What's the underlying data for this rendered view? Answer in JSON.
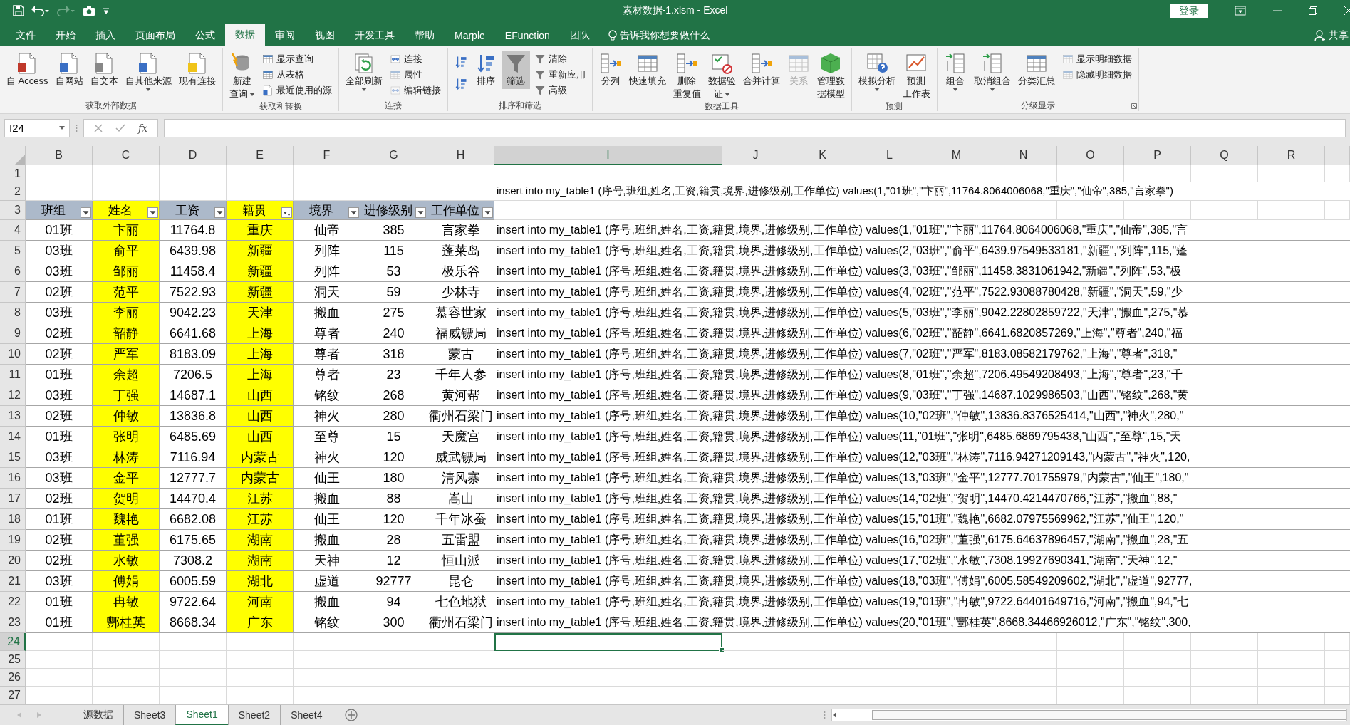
{
  "title_bar": {
    "title": "素材数据-1.xlsm - Excel",
    "login": "登录",
    "quick_access": [
      {
        "kind": "save",
        "disabled": false
      },
      {
        "kind": "undo",
        "disabled": false
      },
      {
        "kind": "redo",
        "disabled": true
      },
      {
        "kind": "camera",
        "disabled": false
      }
    ]
  },
  "menu_tabs": [
    {
      "label": "文件",
      "selected": false
    },
    {
      "label": "开始",
      "selected": false
    },
    {
      "label": "插入",
      "selected": false
    },
    {
      "label": "页面布局",
      "selected": false
    },
    {
      "label": "公式",
      "selected": false
    },
    {
      "label": "数据",
      "selected": true
    },
    {
      "label": "审阅",
      "selected": false
    },
    {
      "label": "视图",
      "selected": false
    },
    {
      "label": "开发工具",
      "selected": false
    },
    {
      "label": "帮助",
      "selected": false
    },
    {
      "label": "Marple",
      "selected": false
    },
    {
      "label": "EFunction",
      "selected": false
    },
    {
      "label": "团队",
      "selected": false
    }
  ],
  "tell_me": "告诉我你想要做什么",
  "share": "共享",
  "ribbon": {
    "groups": [
      {
        "label": "获取外部数据",
        "items": [
          {
            "kind": "large",
            "lines": [
              "自 Access"
            ],
            "disabled": false,
            "pressed": false,
            "dropdown": false
          },
          {
            "kind": "large",
            "lines": [
              "自网站"
            ],
            "disabled": false,
            "pressed": false,
            "dropdown": false
          },
          {
            "kind": "large",
            "lines": [
              "自文本"
            ],
            "disabled": false,
            "pressed": false,
            "dropdown": false
          },
          {
            "kind": "large",
            "lines": [
              "自其他来源"
            ],
            "disabled": false,
            "pressed": false,
            "dropdown": true
          },
          {
            "kind": "large",
            "lines": [
              "现有连接"
            ],
            "disabled": false,
            "pressed": false,
            "dropdown": false
          }
        ]
      },
      {
        "label": "获取和转换",
        "items": [
          {
            "kind": "large",
            "lines": [
              "新建",
              "查询"
            ],
            "disabled": false,
            "pressed": false,
            "dropdown": true
          },
          {
            "kind": "small",
            "label": "显示查询",
            "disabled": false,
            "pressed": false,
            "dropdown": false
          },
          {
            "kind": "small",
            "label": "从表格",
            "disabled": false,
            "pressed": false,
            "dropdown": false
          },
          {
            "kind": "small",
            "label": "最近使用的源",
            "disabled": false,
            "pressed": false,
            "dropdown": false
          }
        ]
      },
      {
        "label": "连接",
        "items": [
          {
            "kind": "large",
            "lines": [
              "全部刷新"
            ],
            "disabled": false,
            "pressed": false,
            "dropdown": true
          },
          {
            "kind": "small",
            "label": "连接",
            "disabled": false,
            "pressed": false,
            "dropdown": false
          },
          {
            "kind": "small",
            "label": "属性",
            "disabled": true,
            "pressed": false,
            "dropdown": false
          },
          {
            "kind": "small",
            "label": "编辑链接",
            "disabled": true,
            "pressed": false,
            "dropdown": false
          }
        ]
      },
      {
        "label": "排序和筛选",
        "items": [
          {
            "kind": "icon",
            "disabled": false,
            "pressed": false,
            "dropdown": false
          },
          {
            "kind": "icon",
            "disabled": false,
            "pressed": false,
            "dropdown": false
          },
          {
            "kind": "large",
            "lines": [
              "排序"
            ],
            "disabled": false,
            "pressed": false,
            "dropdown": false
          },
          {
            "kind": "large",
            "lines": [
              "筛选"
            ],
            "disabled": false,
            "pressed": true,
            "dropdown": false
          },
          {
            "kind": "small",
            "label": "清除",
            "disabled": false,
            "pressed": false,
            "dropdown": false
          },
          {
            "kind": "small",
            "label": "重新应用",
            "disabled": false,
            "pressed": false,
            "dropdown": false
          },
          {
            "kind": "small",
            "label": "高级",
            "disabled": false,
            "pressed": false,
            "dropdown": false
          }
        ]
      },
      {
        "label": "数据工具",
        "items": [
          {
            "kind": "large",
            "lines": [
              "分列"
            ],
            "disabled": false,
            "pressed": false,
            "dropdown": false
          },
          {
            "kind": "large",
            "lines": [
              "快速填充"
            ],
            "disabled": false,
            "pressed": false,
            "dropdown": false
          },
          {
            "kind": "large",
            "lines": [
              "删除",
              "重复值"
            ],
            "disabled": false,
            "pressed": false,
            "dropdown": false
          },
          {
            "kind": "large",
            "lines": [
              "数据验",
              "证"
            ],
            "disabled": false,
            "pressed": false,
            "dropdown": true
          },
          {
            "kind": "large",
            "lines": [
              "合并计算"
            ],
            "disabled": false,
            "pressed": false,
            "dropdown": false
          },
          {
            "kind": "large",
            "lines": [
              "关系"
            ],
            "disabled": true,
            "pressed": false,
            "dropdown": false
          },
          {
            "kind": "large",
            "lines": [
              "管理数",
              "据模型"
            ],
            "disabled": false,
            "pressed": false,
            "dropdown": false
          }
        ]
      },
      {
        "label": "预测",
        "items": [
          {
            "kind": "large",
            "lines": [
              "模拟分析"
            ],
            "disabled": false,
            "pressed": false,
            "dropdown": true
          },
          {
            "kind": "large",
            "lines": [
              "预测",
              "工作表"
            ],
            "disabled": false,
            "pressed": false,
            "dropdown": false
          }
        ]
      },
      {
        "label": "分级显示",
        "items": [
          {
            "kind": "large",
            "lines": [
              "组合"
            ],
            "disabled": false,
            "pressed": false,
            "dropdown": true
          },
          {
            "kind": "large",
            "lines": [
              "取消组合"
            ],
            "disabled": false,
            "pressed": false,
            "dropdown": true
          },
          {
            "kind": "large",
            "lines": [
              "分类汇总"
            ],
            "disabled": false,
            "pressed": false,
            "dropdown": false
          },
          {
            "kind": "small",
            "label": "显示明细数据",
            "disabled": true,
            "pressed": false,
            "dropdown": false
          },
          {
            "kind": "small",
            "label": "隐藏明细数据",
            "disabled": true,
            "pressed": false,
            "dropdown": false
          }
        ]
      }
    ]
  },
  "formula_bar": {
    "name_box": "I24",
    "fx": "fx"
  },
  "column_letters": [
    {
      "label": "B",
      "selected": false
    },
    {
      "label": "C",
      "selected": false
    },
    {
      "label": "D",
      "selected": false
    },
    {
      "label": "E",
      "selected": false
    },
    {
      "label": "F",
      "selected": false
    },
    {
      "label": "G",
      "selected": false
    },
    {
      "label": "H",
      "selected": false
    },
    {
      "label": "I",
      "selected": true
    },
    {
      "label": "J",
      "selected": false
    },
    {
      "label": "K",
      "selected": false
    },
    {
      "label": "L",
      "selected": false
    },
    {
      "label": "M",
      "selected": false
    },
    {
      "label": "N",
      "selected": false
    },
    {
      "label": "O",
      "selected": false
    },
    {
      "label": "P",
      "selected": false
    },
    {
      "label": "Q",
      "selected": false
    },
    {
      "label": "R",
      "selected": false
    }
  ],
  "row_numbers": [
    {
      "label": "1",
      "selected": false
    },
    {
      "label": "2",
      "selected": false
    },
    {
      "label": "3",
      "selected": false
    },
    {
      "label": "4",
      "selected": false
    },
    {
      "label": "5",
      "selected": false
    },
    {
      "label": "6",
      "selected": false
    },
    {
      "label": "7",
      "selected": false
    },
    {
      "label": "8",
      "selected": false
    },
    {
      "label": "9",
      "selected": false
    },
    {
      "label": "10",
      "selected": false
    },
    {
      "label": "11",
      "selected": false
    },
    {
      "label": "12",
      "selected": false
    },
    {
      "label": "13",
      "selected": false
    },
    {
      "label": "14",
      "selected": false
    },
    {
      "label": "15",
      "selected": false
    },
    {
      "label": "16",
      "selected": false
    },
    {
      "label": "17",
      "selected": false
    },
    {
      "label": "18",
      "selected": false
    },
    {
      "label": "19",
      "selected": false
    },
    {
      "label": "20",
      "selected": false
    },
    {
      "label": "21",
      "selected": false
    },
    {
      "label": "22",
      "selected": false
    },
    {
      "label": "23",
      "selected": false
    },
    {
      "label": "24",
      "selected": true
    },
    {
      "label": "25",
      "selected": false
    },
    {
      "label": "26",
      "selected": false
    },
    {
      "label": "27",
      "selected": false
    }
  ],
  "cell_i2": "insert into my_table1 (序号,班组,姓名,工资,籍贯,境界,进修级别,工作单位) values(1,\"01班\",\"卞丽\",11764.8064006068,\"重庆\",\"仙帝\",385,\"言家拳\")",
  "table": {
    "columns": [
      {
        "label": "班组",
        "highlighted": false,
        "sorted": false
      },
      {
        "label": "姓名",
        "highlighted": true,
        "sorted": false
      },
      {
        "label": "工资",
        "highlighted": false,
        "sorted": false
      },
      {
        "label": "籍贯",
        "highlighted": true,
        "sorted": true
      },
      {
        "label": "境界",
        "highlighted": false,
        "sorted": false
      },
      {
        "label": "进修级别",
        "highlighted": false,
        "sorted": false
      },
      {
        "label": "工作单位",
        "highlighted": false,
        "sorted": false
      }
    ],
    "rows": [
      {
        "cells": [
          "01班",
          "卞丽",
          "11764.8",
          "重庆",
          "仙帝",
          "385",
          "言家拳"
        ],
        "sql": "insert into my_table1 (序号,班组,姓名,工资,籍贯,境界,进修级别,工作单位) values(1,\"01班\",\"卞丽\",11764.8064006068,\"重庆\",\"仙帝\",385,\"言"
      },
      {
        "cells": [
          "03班",
          "俞平",
          "6439.98",
          "新疆",
          "列阵",
          "115",
          "蓬莱岛"
        ],
        "sql": "insert into my_table1 (序号,班组,姓名,工资,籍贯,境界,进修级别,工作单位) values(2,\"03班\",\"俞平\",6439.97549533181,\"新疆\",\"列阵\",115,\"蓬"
      },
      {
        "cells": [
          "03班",
          "邹丽",
          "11458.4",
          "新疆",
          "列阵",
          "53",
          "极乐谷"
        ],
        "sql": "insert into my_table1 (序号,班组,姓名,工资,籍贯,境界,进修级别,工作单位) values(3,\"03班\",\"邹丽\",11458.3831061942,\"新疆\",\"列阵\",53,\"极"
      },
      {
        "cells": [
          "02班",
          "范平",
          "7522.93",
          "新疆",
          "洞天",
          "59",
          "少林寺"
        ],
        "sql": "insert into my_table1 (序号,班组,姓名,工资,籍贯,境界,进修级别,工作单位) values(4,\"02班\",\"范平\",7522.93088780428,\"新疆\",\"洞天\",59,\"少"
      },
      {
        "cells": [
          "03班",
          "李丽",
          "9042.23",
          "天津",
          "搬血",
          "275",
          "慕容世家"
        ],
        "sql": "insert into my_table1 (序号,班组,姓名,工资,籍贯,境界,进修级别,工作单位) values(5,\"03班\",\"李丽\",9042.22802859722,\"天津\",\"搬血\",275,\"慕"
      },
      {
        "cells": [
          "02班",
          "韶静",
          "6641.68",
          "上海",
          "尊者",
          "240",
          "福威镖局"
        ],
        "sql": "insert into my_table1 (序号,班组,姓名,工资,籍贯,境界,进修级别,工作单位) values(6,\"02班\",\"韶静\",6641.6820857269,\"上海\",\"尊者\",240,\"福"
      },
      {
        "cells": [
          "02班",
          "严军",
          "8183.09",
          "上海",
          "尊者",
          "318",
          "蒙古"
        ],
        "sql": "insert into my_table1 (序号,班组,姓名,工资,籍贯,境界,进修级别,工作单位) values(7,\"02班\",\"严军\",8183.08582179762,\"上海\",\"尊者\",318,\""
      },
      {
        "cells": [
          "01班",
          "余超",
          "7206.5",
          "上海",
          "尊者",
          "23",
          "千年人参"
        ],
        "sql": "insert into my_table1 (序号,班组,姓名,工资,籍贯,境界,进修级别,工作单位) values(8,\"01班\",\"余超\",7206.49549208493,\"上海\",\"尊者\",23,\"千"
      },
      {
        "cells": [
          "03班",
          "丁强",
          "14687.1",
          "山西",
          "铭纹",
          "268",
          "黄河帮"
        ],
        "sql": "insert into my_table1 (序号,班组,姓名,工资,籍贯,境界,进修级别,工作单位) values(9,\"03班\",\"丁强\",14687.1029986503,\"山西\",\"铭纹\",268,\"黄"
      },
      {
        "cells": [
          "02班",
          "仲敏",
          "13836.8",
          "山西",
          "神火",
          "280",
          "衢州石梁门"
        ],
        "sql": "insert into my_table1 (序号,班组,姓名,工资,籍贯,境界,进修级别,工作单位) values(10,\"02班\",\"仲敏\",13836.8376525414,\"山西\",\"神火\",280,\""
      },
      {
        "cells": [
          "01班",
          "张明",
          "6485.69",
          "山西",
          "至尊",
          "15",
          "天魔宫"
        ],
        "sql": "insert into my_table1 (序号,班组,姓名,工资,籍贯,境界,进修级别,工作单位) values(11,\"01班\",\"张明\",6485.6869795438,\"山西\",\"至尊\",15,\"天"
      },
      {
        "cells": [
          "03班",
          "林涛",
          "7116.94",
          "内蒙古",
          "神火",
          "120",
          "威武镖局"
        ],
        "sql": "insert into my_table1 (序号,班组,姓名,工资,籍贯,境界,进修级别,工作单位) values(12,\"03班\",\"林涛\",7116.94271209143,\"内蒙古\",\"神火\",120,"
      },
      {
        "cells": [
          "03班",
          "金平",
          "12777.7",
          "内蒙古",
          "仙王",
          "180",
          "清风寨"
        ],
        "sql": "insert into my_table1 (序号,班组,姓名,工资,籍贯,境界,进修级别,工作单位) values(13,\"03班\",\"金平\",12777.701755979,\"内蒙古\",\"仙王\",180,\""
      },
      {
        "cells": [
          "02班",
          "贺明",
          "14470.4",
          "江苏",
          "搬血",
          "88",
          "嵩山"
        ],
        "sql": "insert into my_table1 (序号,班组,姓名,工资,籍贯,境界,进修级别,工作单位) values(14,\"02班\",\"贺明\",14470.4214470766,\"江苏\",\"搬血\",88,\""
      },
      {
        "cells": [
          "01班",
          "魏艳",
          "6682.08",
          "江苏",
          "仙王",
          "120",
          "千年冰蚕"
        ],
        "sql": "insert into my_table1 (序号,班组,姓名,工资,籍贯,境界,进修级别,工作单位) values(15,\"01班\",\"魏艳\",6682.07975569962,\"江苏\",\"仙王\",120,\""
      },
      {
        "cells": [
          "02班",
          "董强",
          "6175.65",
          "湖南",
          "搬血",
          "28",
          "五雷盟"
        ],
        "sql": "insert into my_table1 (序号,班组,姓名,工资,籍贯,境界,进修级别,工作单位) values(16,\"02班\",\"董强\",6175.64637896457,\"湖南\",\"搬血\",28,\"五"
      },
      {
        "cells": [
          "02班",
          "水敏",
          "7308.2",
          "湖南",
          "天神",
          "12",
          "恒山派"
        ],
        "sql": "insert into my_table1 (序号,班组,姓名,工资,籍贯,境界,进修级别,工作单位) values(17,\"02班\",\"水敏\",7308.19927690341,\"湖南\",\"天神\",12,\""
      },
      {
        "cells": [
          "03班",
          "傅娟",
          "6005.59",
          "湖北",
          "虚道",
          "92777",
          "昆仑"
        ],
        "sql": "insert into my_table1 (序号,班组,姓名,工资,籍贯,境界,进修级别,工作单位) values(18,\"03班\",\"傅娟\",6005.58549209602,\"湖北\",\"虚道\",92777,"
      },
      {
        "cells": [
          "01班",
          "冉敏",
          "9722.64",
          "河南",
          "搬血",
          "94",
          "七色地狱"
        ],
        "sql": "insert into my_table1 (序号,班组,姓名,工资,籍贯,境界,进修级别,工作单位) values(19,\"01班\",\"冉敏\",9722.64401649716,\"河南\",\"搬血\",94,\"七"
      },
      {
        "cells": [
          "01班",
          "酆桂英",
          "8668.34",
          "广东",
          "铭纹",
          "300",
          "衢州石梁门"
        ],
        "sql": "insert into my_table1 (序号,班组,姓名,工资,籍贯,境界,进修级别,工作单位) values(20,\"01班\",\"酆桂英\",8668.34466926012,\"广东\",\"铭纹\",300,"
      }
    ]
  },
  "sheet_tabs": [
    {
      "label": "源数据",
      "selected": false
    },
    {
      "label": "Sheet3",
      "selected": false
    },
    {
      "label": "Sheet1",
      "selected": true
    },
    {
      "label": "Sheet2",
      "selected": false
    },
    {
      "label": "Sheet4",
      "selected": false
    }
  ]
}
